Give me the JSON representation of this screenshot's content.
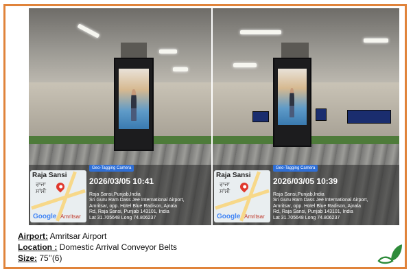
{
  "photos": [
    {
      "map_labels": [
        "Raja Sansi",
        "ਰਾਜਾ",
        "ਸਾਂਸੀ"
      ],
      "map_google": "Google",
      "map_town": "Amritsar",
      "badge": "Geo-Tagging Camera",
      "datetime": "2026/03/05 10:41",
      "address_lines": [
        "Raja Sansi,Punjab,India",
        "Sri Guru Ram Dass Jee International Airport,",
        "Amritsar, opp. Hotel Blue Radison, Ajnala",
        "Rd, Raja Sansi, Punjab 143101, India",
        "Lat 31.705648 Long 74.806237"
      ]
    },
    {
      "map_labels": [
        "Raja Sansi",
        "ਰਾਜਾ",
        "ਸਾਂਸੀ"
      ],
      "map_google": "Google",
      "map_town": "Amritsar",
      "badge": "Geo-Tagging Camera",
      "datetime": "2026/03/05 10:39",
      "address_lines": [
        "Raja Sansi,Punjab,India",
        "Sri Guru Ram Dass Jee International Airport,",
        "Amritsar, opp. Hotel Blue Radison, Ajnala",
        "Rd, Raja Sansi, Punjab 143101, India",
        "Lat 31.705648 Long 74.806237"
      ]
    }
  ],
  "info": {
    "airport_label": "Airport:",
    "airport_value": " Amritsar Airport",
    "location_label": "Location :",
    "location_value": " Domestic Arrival Conveyor Belts",
    "size_label": "Size:",
    "size_value": " 75’’(6)"
  },
  "colors": {
    "frame": "#e0833a",
    "badge": "#2f6fd6",
    "leaf": "#2e8b3a"
  },
  "icons": {
    "pin": "map-pin-icon",
    "leaf": "leaf-logo-icon"
  }
}
